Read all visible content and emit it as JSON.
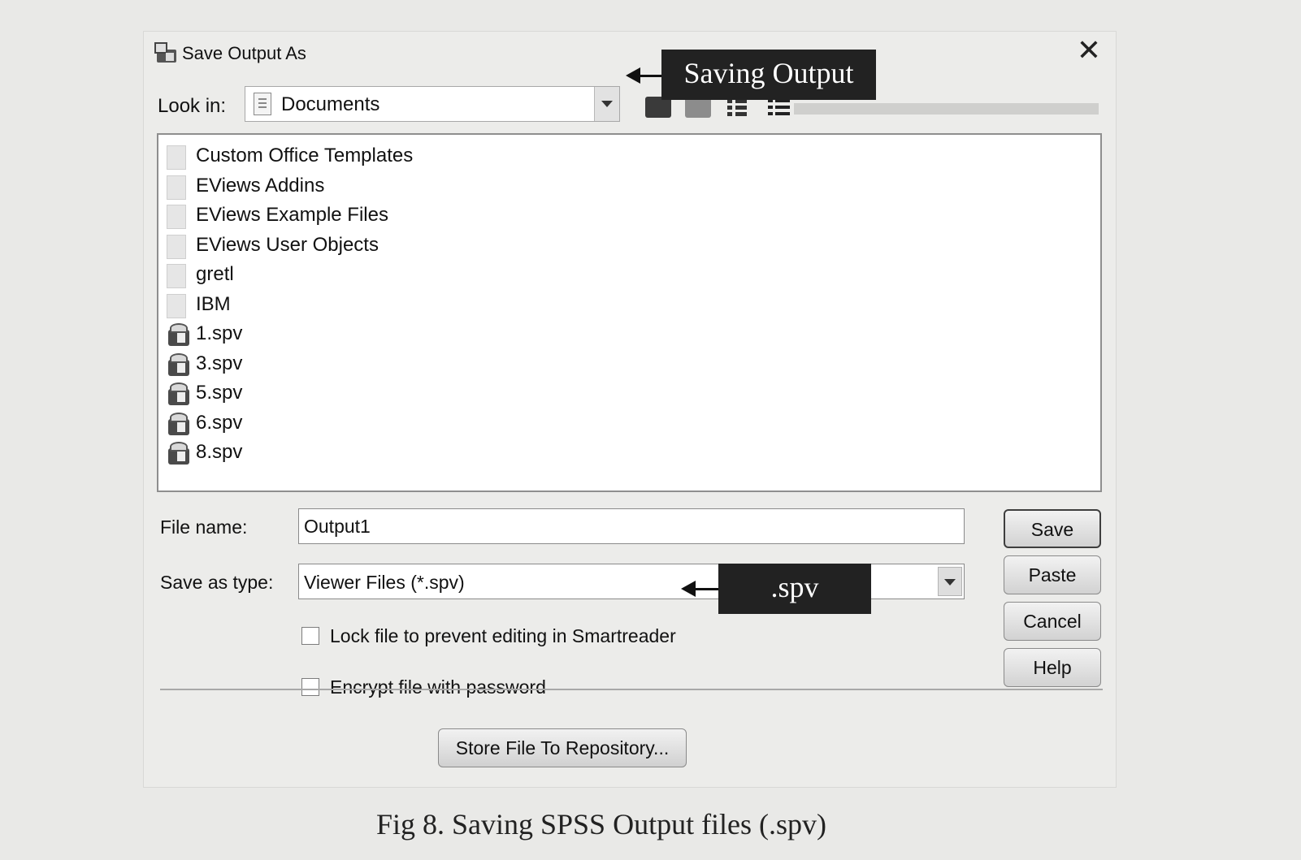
{
  "dialog": {
    "title": "Save Output As",
    "look_in_label": "Look in:",
    "look_in_value": "Documents",
    "files": [
      {
        "name": "Custom Office Templates",
        "type": "folder"
      },
      {
        "name": "EViews Addins",
        "type": "folder"
      },
      {
        "name": "EViews Example Files",
        "type": "folder"
      },
      {
        "name": "EViews User Objects",
        "type": "folder"
      },
      {
        "name": "gretl",
        "type": "folder"
      },
      {
        "name": "IBM",
        "type": "folder"
      },
      {
        "name": "1.spv",
        "type": "spv"
      },
      {
        "name": "3.spv",
        "type": "spv"
      },
      {
        "name": "5.spv",
        "type": "spv"
      },
      {
        "name": "6.spv",
        "type": "spv"
      },
      {
        "name": "8.spv",
        "type": "spv"
      }
    ],
    "file_name_label": "File name:",
    "file_name_value": "Output1",
    "save_as_type_label": "Save as type:",
    "save_as_type_value": "Viewer Files (*.spv)",
    "lock_label": "Lock file to prevent editing in Smartreader",
    "encrypt_label": "Encrypt file with password",
    "buttons": {
      "save": "Save",
      "paste": "Paste",
      "cancel": "Cancel",
      "help": "Help"
    },
    "repository_button": "Store File To Repository..."
  },
  "annotations": {
    "saving_output": "Saving Output",
    "spv": ".spv"
  },
  "caption": "Fig 8. Saving SPSS Output files (.spv)",
  "colors": {
    "callout_bg": "#222222",
    "dialog_bg": "#ececea"
  }
}
